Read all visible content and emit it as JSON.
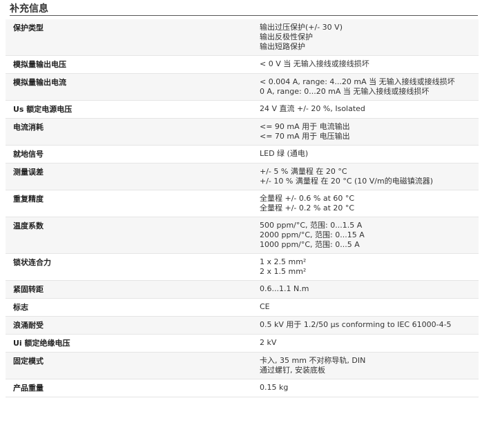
{
  "section": {
    "title": "补充信息"
  },
  "rows": [
    {
      "label": "保护类型",
      "values": [
        "输出过压保护(+/- 30 V)",
        "输出反极性保护",
        "输出短路保护"
      ]
    },
    {
      "label": "模拟量输出电压",
      "values": [
        "< 0 V 当 无输入接线或接线损坏"
      ]
    },
    {
      "label": "模拟量输出电流",
      "values": [
        "< 0.004 A, range: 4...20 mA 当 无输入接线或接线损坏",
        "0 A, range: 0...20 mA 当 无输入接线或接线损坏"
      ]
    },
    {
      "label": "Us 额定电源电压",
      "values": [
        "24 V 直流 +/- 20 %, Isolated"
      ]
    },
    {
      "label": "电流消耗",
      "values": [
        "<= 90 mA 用于 电流输出",
        "<= 70 mA 用于 电压输出"
      ]
    },
    {
      "label": "就地信号",
      "values": [
        "LED 绿 (通电)"
      ]
    },
    {
      "label": "测量误差",
      "values": [
        "+/- 5 % 满量程 在 20 °C",
        "+/- 10 % 满量程 在 20 °C (10 V/m的电磁镇流器)"
      ]
    },
    {
      "label": "重复精度",
      "values": [
        "全量程 +/- 0.6 % at 60 °C",
        "全量程 +/- 0.2 % at 20 °C"
      ]
    },
    {
      "label": "温度系数",
      "values": [
        "500 ppm/°C, 范围: 0...1.5 A",
        "2000 ppm/°C, 范围: 0...15 A",
        "1000 ppm/°C, 范围: 0...5 A"
      ]
    },
    {
      "label": "锁状连合力",
      "values": [
        "1 x 2.5 mm²",
        "2 x 1.5 mm²"
      ]
    },
    {
      "label": "紧固转距",
      "values": [
        "0.6...1.1 N.m"
      ]
    },
    {
      "label": "标志",
      "values": [
        "CE"
      ]
    },
    {
      "label": "浪涌耐受",
      "values": [
        "0.5 kV 用于 1.2/50 µs conforming to IEC 61000-4-5"
      ]
    },
    {
      "label": "Ui 额定绝缘电压",
      "values": [
        "2 kV"
      ]
    },
    {
      "label": "固定模式",
      "values": [
        "卡入, 35 mm 不对称导轨, DIN",
        "通过螺钉, 安装底板"
      ]
    },
    {
      "label": "产品重量",
      "values": [
        "0.15 kg"
      ]
    }
  ]
}
